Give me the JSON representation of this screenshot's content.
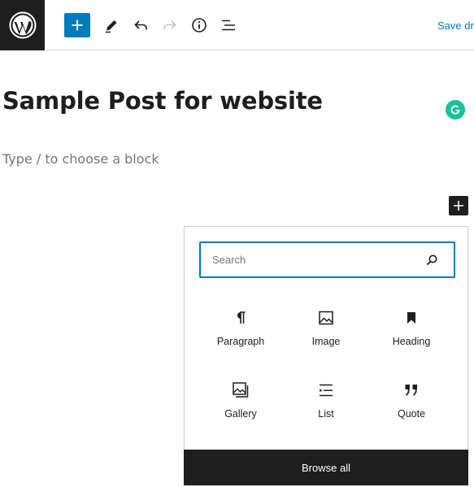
{
  "toolbar": {
    "save_label": "Save draft"
  },
  "editor": {
    "title": "Sample Post for website",
    "placeholder": "Type / to choose a block"
  },
  "inserter": {
    "search_placeholder": "Search",
    "blocks": [
      {
        "label": "Paragraph",
        "icon": "paragraph-icon"
      },
      {
        "label": "Image",
        "icon": "image-icon"
      },
      {
        "label": "Heading",
        "icon": "heading-icon"
      },
      {
        "label": "Gallery",
        "icon": "gallery-icon"
      },
      {
        "label": "List",
        "icon": "list-icon"
      },
      {
        "label": "Quote",
        "icon": "quote-icon"
      }
    ],
    "browse_all_label": "Browse all"
  },
  "colors": {
    "accent": "#007cba",
    "dark": "#1e1e1e",
    "grammarly": "#15c39a"
  }
}
